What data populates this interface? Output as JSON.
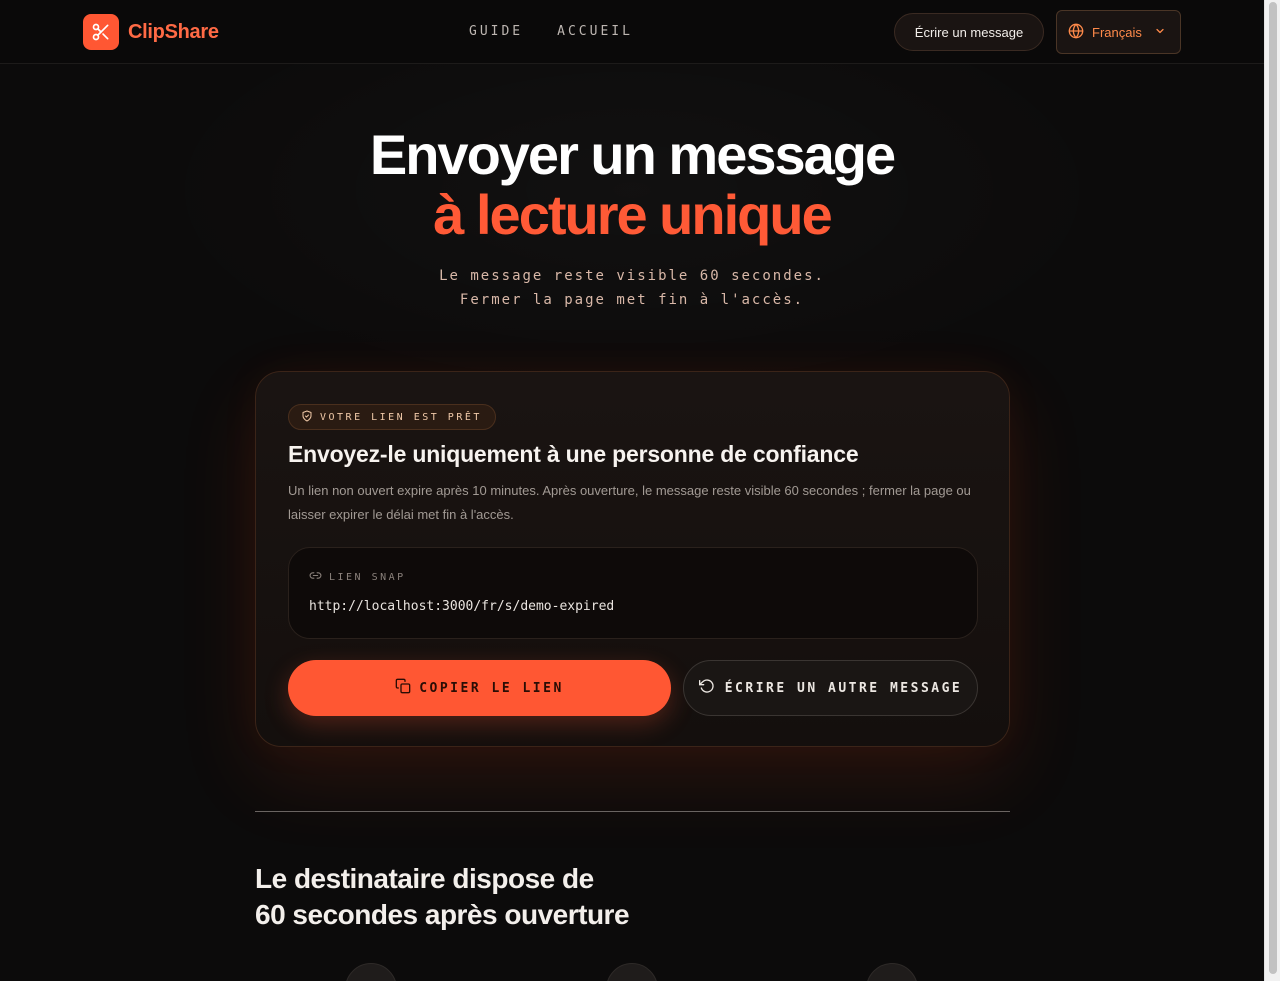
{
  "header": {
    "brand": "ClipShare",
    "nav": [
      {
        "label": "GUIDE"
      },
      {
        "label": "ACCUEIL"
      }
    ],
    "write_button": "Écrire un message",
    "language": "Français"
  },
  "hero": {
    "title_line1": "Envoyer un message",
    "title_line2": "à lecture unique",
    "subtitle_line1": "Le message reste visible 60 secondes.",
    "subtitle_line2": "Fermer la page met fin à l'accès."
  },
  "card": {
    "badge": "VOTRE LIEN EST PRÊT",
    "title": "Envoyez-le uniquement à une personne de confiance",
    "description": "Un lien non ouvert expire après 10 minutes. Après ouverture, le message reste visible 60 secondes ; fermer la page ou laisser expirer le délai met fin à l'accès.",
    "link_label": "LIEN SNAP",
    "link_url": "http://localhost:3000/fr/s/demo-expired",
    "copy_button": "COPIER LE LIEN",
    "another_button": "ÉCRIRE UN AUTRE MESSAGE"
  },
  "section": {
    "title_line1": "Le destinataire dispose de",
    "title_line2": "60 secondes après ouverture"
  },
  "colors": {
    "accent": "#ff5733",
    "background": "#0c0b0b"
  },
  "icons": {
    "logo": "scissors-icon",
    "language": "globe-icon",
    "language_toggle": "chevron-down-icon",
    "badge": "shield-check-icon",
    "link": "link-icon",
    "copy": "copy-icon",
    "another": "rotate-ccw-icon"
  }
}
